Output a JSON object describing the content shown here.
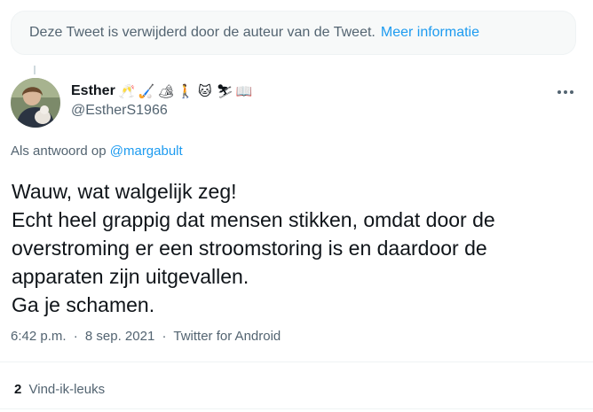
{
  "notice": {
    "text": "Deze Tweet is verwijderd door de auteur van de Tweet.",
    "link": "Meer informatie"
  },
  "tweet": {
    "author": {
      "name": "Esther",
      "handle": "@EstherS1966",
      "emojis": [
        {
          "icon": "clinking-glasses-icon",
          "glyph": "🥂"
        },
        {
          "icon": "hockey-stick-icon",
          "glyph": "🏑"
        },
        {
          "icon": "camping-tent-icon",
          "glyph": "🏕"
        },
        {
          "icon": "person-walking-icon",
          "glyph": "🚶"
        },
        {
          "icon": "cat-face-icon",
          "glyph": "🐱"
        },
        {
          "icon": "skier-icon",
          "glyph": "⛷"
        },
        {
          "icon": "open-book-icon",
          "glyph": "📖"
        }
      ]
    },
    "reply_prefix": "Als antwoord op",
    "reply_mention": "@margabult",
    "text_lines": [
      "Wauw, wat walgelijk zeg!",
      "Echt heel grappig dat mensen stikken, omdat door de",
      "overstroming er een stroomstoring is en daardoor de",
      "apparaten zijn uitgevallen.",
      "Ga je schamen."
    ],
    "time": "6:42 p.m.",
    "date": "8 sep. 2021",
    "source": "Twitter for Android",
    "separator": "·",
    "likes_count": "2",
    "likes_label": "Vind-ik-leuks"
  },
  "colors": {
    "link": "#1d9bf0",
    "secondary_text": "#536471",
    "primary_text": "#0f1419"
  }
}
